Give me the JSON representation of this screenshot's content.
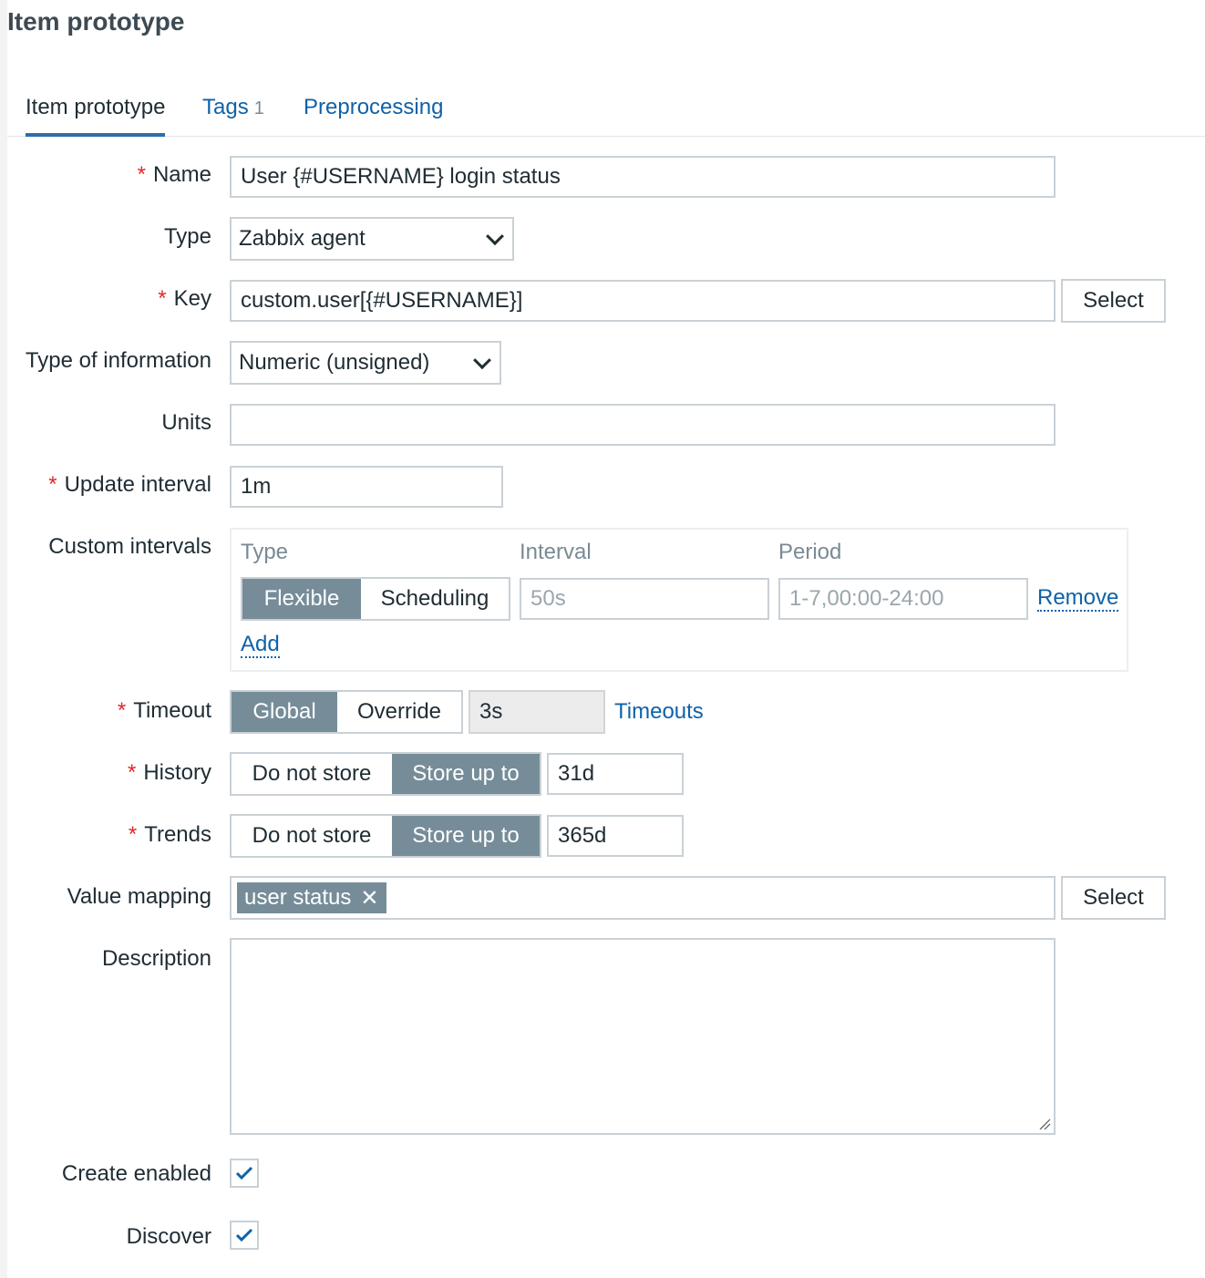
{
  "page": {
    "title": "Item prototype"
  },
  "tabs": [
    {
      "label": "Item prototype",
      "active": true
    },
    {
      "label": "Tags",
      "count": "1"
    },
    {
      "label": "Preprocessing"
    }
  ],
  "form": {
    "name": {
      "label": "Name",
      "value": "User {#USERNAME} login status"
    },
    "type": {
      "label": "Type",
      "value": "Zabbix agent"
    },
    "key": {
      "label": "Key",
      "value": "custom.user[{#USERNAME}]",
      "button": "Select"
    },
    "type_of_information": {
      "label": "Type of information",
      "value": "Numeric (unsigned)"
    },
    "units": {
      "label": "Units",
      "value": ""
    },
    "update_interval": {
      "label": "Update interval",
      "value": "1m"
    },
    "custom_intervals": {
      "label": "Custom intervals",
      "headers": {
        "type": "Type",
        "interval": "Interval",
        "period": "Period"
      },
      "type_options": [
        "Flexible",
        "Scheduling"
      ],
      "selected_type": "Flexible",
      "interval_placeholder": "50s",
      "period_placeholder": "1-7,00:00-24:00",
      "remove_label": "Remove",
      "add_label": "Add"
    },
    "timeout": {
      "label": "Timeout",
      "options": [
        "Global",
        "Override"
      ],
      "selected": "Global",
      "value": "3s",
      "link": "Timeouts"
    },
    "history": {
      "label": "History",
      "options": [
        "Do not store",
        "Store up to"
      ],
      "selected": "Store up to",
      "value": "31d"
    },
    "trends": {
      "label": "Trends",
      "options": [
        "Do not store",
        "Store up to"
      ],
      "selected": "Store up to",
      "value": "365d"
    },
    "value_mapping": {
      "label": "Value mapping",
      "tag": "user status",
      "remove_glyph": "✕",
      "button": "Select"
    },
    "description": {
      "label": "Description",
      "value": ""
    },
    "create_enabled": {
      "label": "Create enabled",
      "checked": true
    },
    "discover": {
      "label": "Discover",
      "checked": true
    }
  },
  "colors": {
    "accent": "#0f62a8",
    "segment_on": "#768d99",
    "required": "#e0282c",
    "border": "#c9d1d6"
  }
}
